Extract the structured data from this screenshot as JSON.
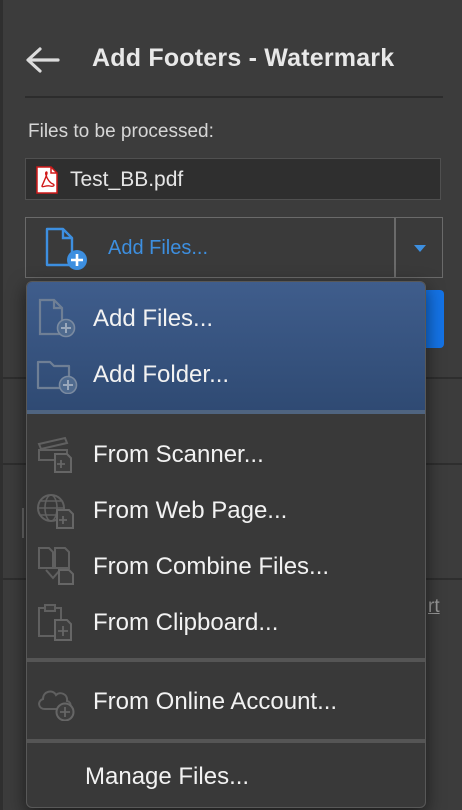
{
  "header": {
    "title": "Add Footers - Watermark"
  },
  "files": {
    "label": "Files to be processed:",
    "items": [
      {
        "name": "Test_BB.pdf",
        "icon": "pdf-file-icon"
      }
    ]
  },
  "add_files_button": {
    "label": "Add Files...",
    "icon": "add-document-icon"
  },
  "background": {
    "partial_link": "rt"
  },
  "menu": {
    "items": [
      {
        "label": "Add Files...",
        "icon": "add-document-icon"
      },
      {
        "label": "Add Folder...",
        "icon": "add-folder-icon"
      },
      {
        "label": "From Scanner...",
        "icon": "scanner-icon"
      },
      {
        "label": "From Web Page...",
        "icon": "web-page-icon"
      },
      {
        "label": "From Combine Files...",
        "icon": "combine-files-icon"
      },
      {
        "label": "From Clipboard...",
        "icon": "clipboard-icon"
      },
      {
        "label": "From Online Account...",
        "icon": "cloud-account-icon"
      },
      {
        "label": "Manage Files..."
      }
    ]
  },
  "colors": {
    "accent": "#3d8fe0",
    "highlight": "#3f5d8c",
    "primary_button": "#1473e6"
  }
}
